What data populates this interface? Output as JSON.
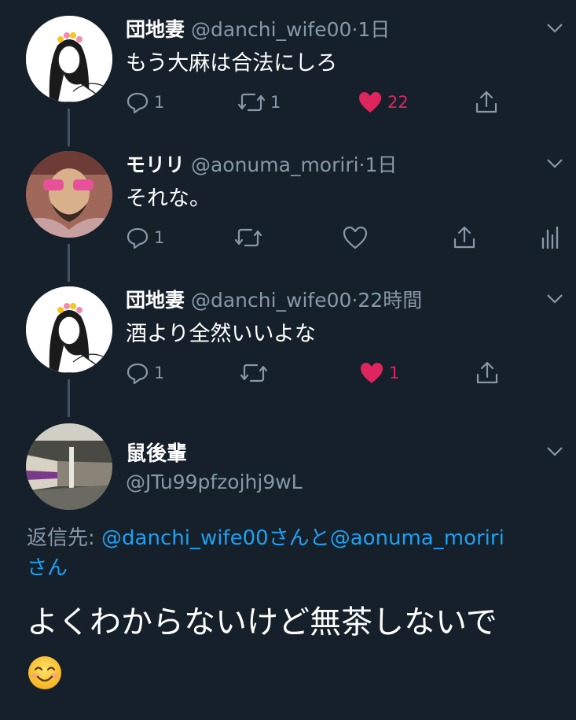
{
  "tweets": [
    {
      "name": "団地妻",
      "handle": "@danchi_wife00",
      "dot": "·",
      "time": "1日",
      "text": "もう大麻は合法にしろ",
      "replies": "1",
      "retweets": "1",
      "likes": "22",
      "liked": true
    },
    {
      "name": "モリリ",
      "handle": "@aonuma_moriri",
      "dot": "·",
      "time": "1日",
      "text": "それな。",
      "replies": "1",
      "retweets": "",
      "likes": "",
      "liked": false
    },
    {
      "name": "団地妻",
      "handle": "@danchi_wife00",
      "dot": "·",
      "time": "22時間",
      "text": "酒より全然いいよな",
      "replies": "1",
      "retweets": "",
      "likes": "1",
      "liked": true
    }
  ],
  "main": {
    "name": "鼠後輩",
    "handle": "@JTu99pfzojhj9wL",
    "reply_prefix": "返信先: ",
    "reply_user1": "@danchi_wife00",
    "reply_mid": "さんと",
    "reply_user2": "@aonuma_moriri",
    "reply_suffix": "さん",
    "text": "よくわからないけど無茶しないで"
  },
  "colors": {
    "background": "#15202b",
    "secondary_text": "#8899a6",
    "link": "#1da1f2",
    "like": "#e0245e",
    "thread_line": "#3d5466"
  },
  "icons": [
    "reply-icon",
    "retweet-icon",
    "heart-icon",
    "share-icon",
    "analytics-icon",
    "chevron-down-icon",
    "smiling-face-emoji"
  ]
}
